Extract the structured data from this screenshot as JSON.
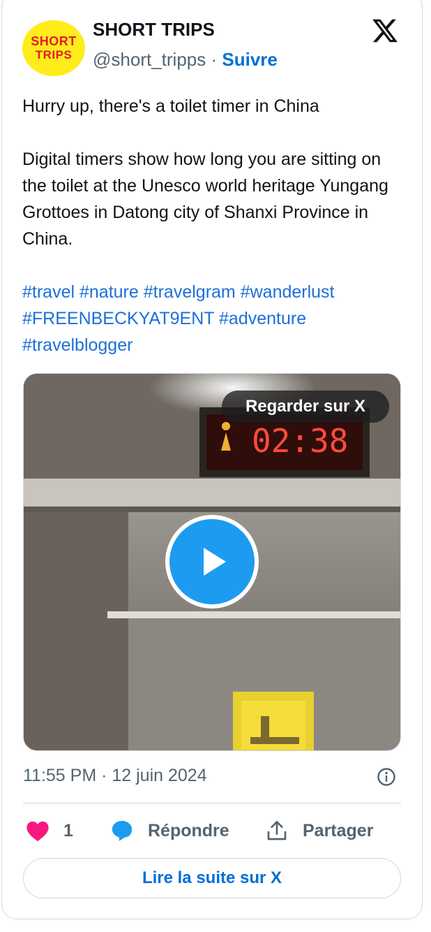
{
  "account": {
    "avatar_line1": "SHORT",
    "avatar_line2": "TRIPS",
    "display_name": "SHORT TRIPS",
    "handle": "@short_tripps",
    "separator": "·",
    "follow_label": "Suivre"
  },
  "tweet": {
    "line1": "Hurry up, there's a toilet timer in China",
    "paragraph2": "Digital timers show how long you are sitting on the toilet at the Unesco world heritage Yungang Grottoes in Datong city of Shanxi Province in China.",
    "hashtags": [
      "#travel",
      "#nature",
      "#travelgram",
      "#wanderlust",
      "#FREENBECKYAT9ENT",
      "#adventure",
      "#travelblogger"
    ]
  },
  "media": {
    "watch_label": "Regarder sur X",
    "timer_display": "02:38"
  },
  "meta": {
    "timestamp": "11:55 PM · 12 juin 2024"
  },
  "actions": {
    "like_count": "1",
    "reply_label": "Répondre",
    "share_label": "Partager"
  },
  "read_more_label": "Lire la suite sur X",
  "colors": {
    "link_blue": "#1d6fd8",
    "play_blue": "#1d9bf0",
    "like_pink": "#f91880",
    "reply_blue": "#1d9bf0",
    "muted_text": "#536471",
    "border": "#cfd9de"
  },
  "icons": {
    "logo": "x-logo-icon",
    "play": "play-icon",
    "info": "info-icon",
    "like": "heart-icon",
    "reply": "speech-bubble-icon",
    "share": "share-upload-icon"
  }
}
